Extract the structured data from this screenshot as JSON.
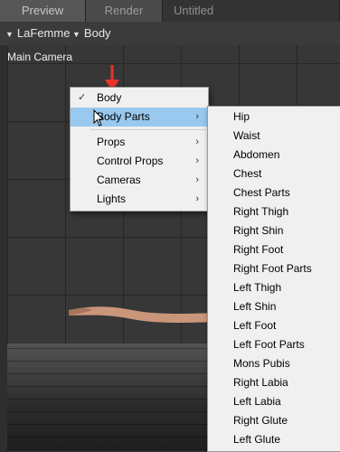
{
  "tabs": [
    "Preview",
    "Render",
    "Untitled"
  ],
  "selectors": {
    "figure": "LaFemme",
    "part": "Body"
  },
  "viewport": {
    "camera_label": "Main Camera"
  },
  "menu1": {
    "items": [
      {
        "label": "Body",
        "checked": true,
        "submenu": false
      },
      {
        "label": "Body Parts",
        "checked": false,
        "submenu": true,
        "highlighted": true
      },
      {
        "label": "Props",
        "checked": false,
        "submenu": true
      },
      {
        "label": "Control Props",
        "checked": false,
        "submenu": true
      },
      {
        "label": "Cameras",
        "checked": false,
        "submenu": true
      },
      {
        "label": "Lights",
        "checked": false,
        "submenu": true
      }
    ]
  },
  "menu2": {
    "items": [
      {
        "label": "Hip",
        "submenu": false
      },
      {
        "label": "Waist",
        "submenu": false
      },
      {
        "label": "Abdomen",
        "submenu": false
      },
      {
        "label": "Chest",
        "submenu": false
      },
      {
        "label": "Chest Parts",
        "submenu": true
      },
      {
        "label": "Right Thigh",
        "submenu": false
      },
      {
        "label": "Right Shin",
        "submenu": false
      },
      {
        "label": "Right Foot",
        "submenu": false
      },
      {
        "label": "Right Foot Parts",
        "submenu": true
      },
      {
        "label": "Left Thigh",
        "submenu": false
      },
      {
        "label": "Left Shin",
        "submenu": false
      },
      {
        "label": "Left Foot",
        "submenu": false
      },
      {
        "label": "Left Foot Parts",
        "submenu": true
      },
      {
        "label": "Mons Pubis",
        "submenu": false
      },
      {
        "label": "Right Labia",
        "submenu": false
      },
      {
        "label": "Left Labia",
        "submenu": false
      },
      {
        "label": "Right Glute",
        "submenu": false
      },
      {
        "label": "Left Glute",
        "submenu": false
      }
    ]
  },
  "glyphs": {
    "check": "✓",
    "chevron": "›",
    "triangle": "▼"
  },
  "colors": {
    "highlight": "#99c9ef",
    "arrow": "#e8332a",
    "menu_bg": "#f0f0f0"
  }
}
